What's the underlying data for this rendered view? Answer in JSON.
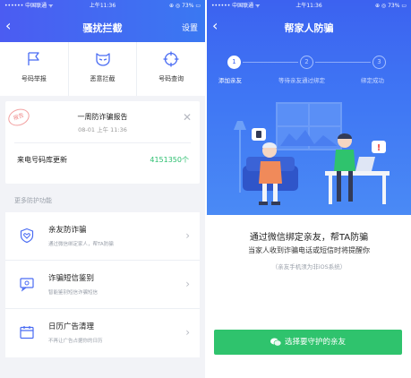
{
  "left": {
    "status": {
      "carrier": "•••••• 中国联通 ᯤ",
      "time": "上午11:36",
      "battery": "⊕ ◎ 73% ▭"
    },
    "nav": {
      "title": "骚扰拦截",
      "action": "设置"
    },
    "quick_actions": [
      {
        "label": "号码举报",
        "icon": "flag-icon"
      },
      {
        "label": "恶意拦截",
        "icon": "mask-icon"
      },
      {
        "label": "号码查询",
        "icon": "target-icon"
      }
    ],
    "report": {
      "stamp": "报告",
      "title": "一周防诈骗报告",
      "date": "08-01 上午 11:36",
      "db_label": "来电号码库更新",
      "db_value": "4151350个"
    },
    "section_title": "更多防护功能",
    "features": [
      {
        "title": "亲友防诈骗",
        "subtitle": "通过微信绑定家人，帮TA防骗",
        "icon": "heart-shield-icon"
      },
      {
        "title": "诈骗短信鉴别",
        "subtitle": "智能鉴别短信诈骗短信",
        "icon": "message-scan-icon"
      },
      {
        "title": "日历广告清理",
        "subtitle": "不再让广告占据你的日历",
        "icon": "calendar-icon"
      }
    ]
  },
  "right": {
    "status": {
      "carrier": "•••••• 中国联通 ᯤ",
      "time": "上午11:36",
      "battery": "⊕ ◎ 73% ▭"
    },
    "nav": {
      "title": "帮家人防骗"
    },
    "steps": [
      {
        "num": "1",
        "label": "添加亲友",
        "active": true
      },
      {
        "num": "2",
        "label": "等待亲友通过绑定",
        "active": false
      },
      {
        "num": "3",
        "label": "绑定成功",
        "active": false
      }
    ],
    "desc_main": "通过微信绑定亲友，帮TA防骗",
    "desc_sub": "当家人收到诈骗电话或短信时将提醒你",
    "desc_note": "（亲友手机须为非iOS系统）",
    "cta_label": "选择要守护的亲友"
  },
  "colors": {
    "brand_blue": "#4b5cf2",
    "green": "#2bbf6f",
    "cta_green": "#2fc36d"
  }
}
